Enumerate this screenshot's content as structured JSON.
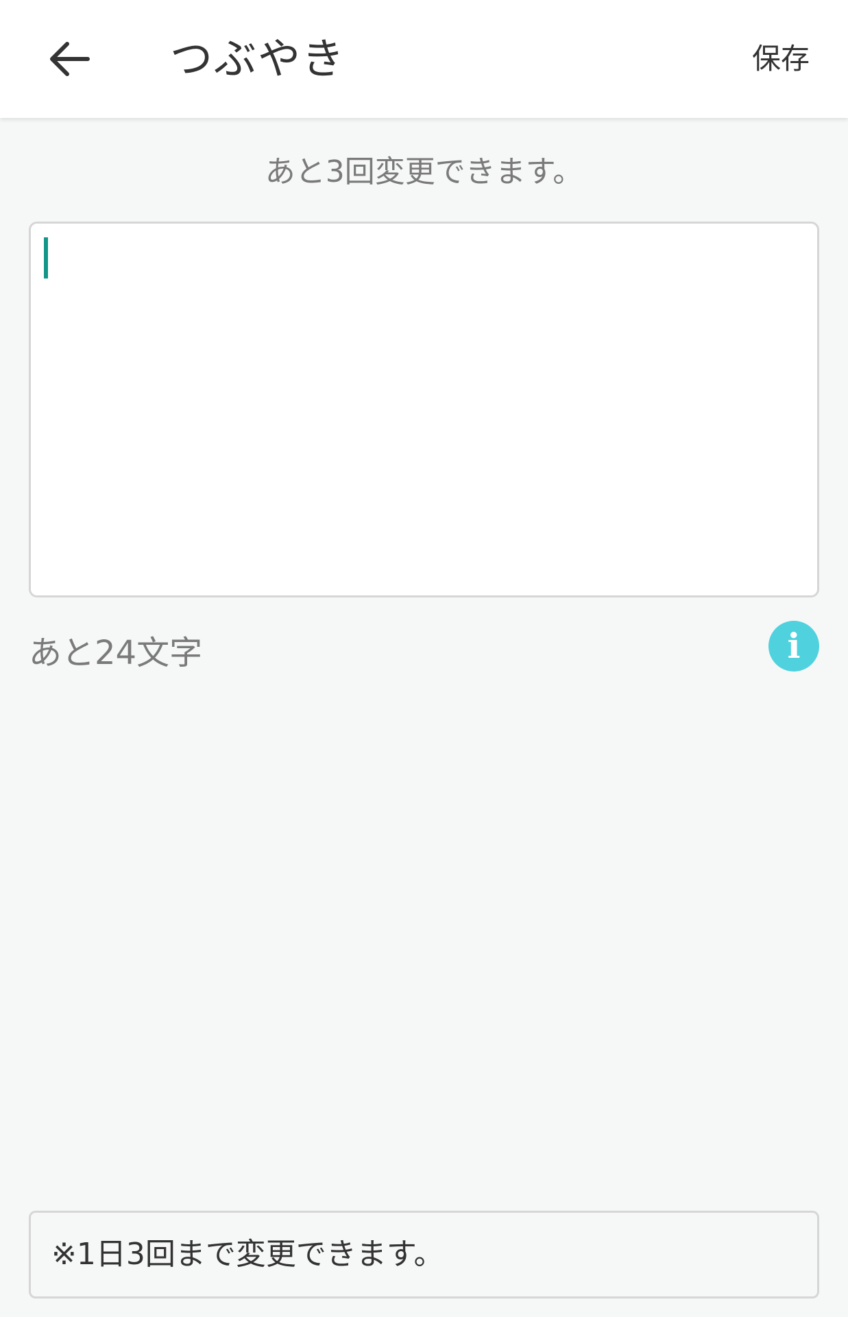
{
  "header": {
    "back_icon": "arrow-left-icon",
    "title": "つぶやき",
    "save_label": "保存"
  },
  "status": {
    "remaining_changes": "あと3回変更できます。"
  },
  "editor": {
    "value": "",
    "placeholder": ""
  },
  "counter": {
    "remaining_chars": "あと24文字"
  },
  "info": {
    "icon": "info-icon",
    "glyph": "i",
    "color": "#4fd2de"
  },
  "notice": {
    "text": "※1日3回まで変更できます。"
  },
  "colors": {
    "accent": "#14958a",
    "background": "#f6f7f7"
  }
}
